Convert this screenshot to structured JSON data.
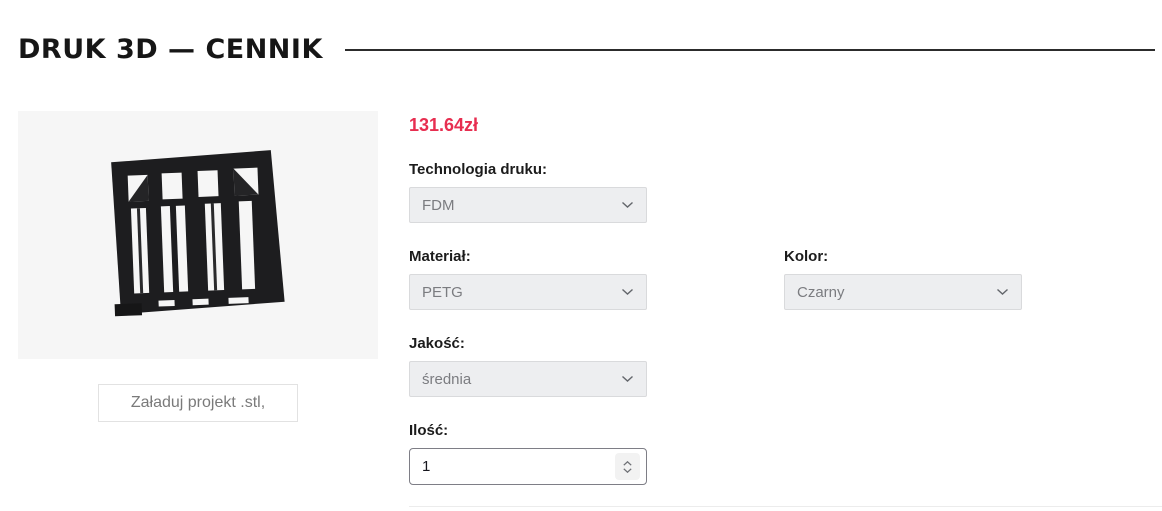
{
  "page": {
    "title": "DRUK 3D — CENNIK"
  },
  "product": {
    "price": "131.64zł",
    "upload_button_label": "Załaduj projekt .stl,"
  },
  "form": {
    "technology": {
      "label": "Technologia druku:",
      "value": "FDM"
    },
    "material": {
      "label": "Materiał:",
      "value": "PETG"
    },
    "color": {
      "label": "Kolor:",
      "value": "Czarny"
    },
    "quality": {
      "label": "Jakość:",
      "value": "średnia"
    },
    "quantity": {
      "label": "Ilość:",
      "value": "1"
    }
  },
  "icons": {
    "select_chevron": "chevron-down-icon",
    "quantity_spinner": "spinner-up-down-icon"
  },
  "colors": {
    "price_text": "#e72e50",
    "title_rule": "#2c2c2c",
    "preview_background": "#f6f6f6",
    "model": "#1d1d1f"
  }
}
